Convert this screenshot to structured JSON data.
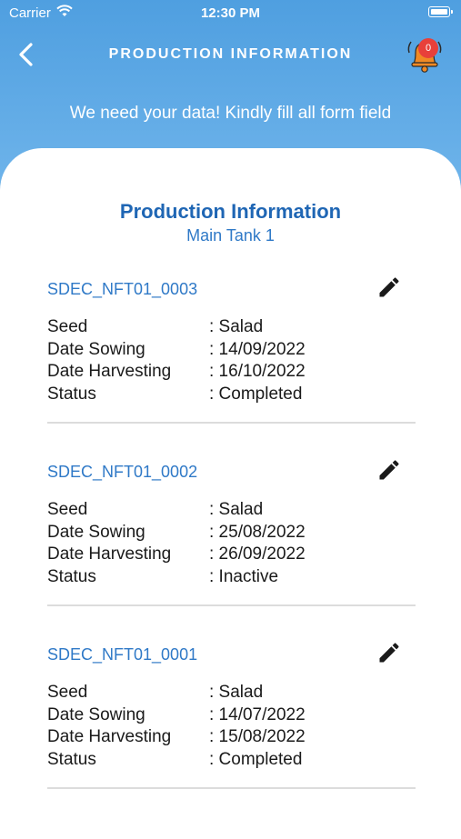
{
  "status_bar": {
    "carrier": "Carrier",
    "time": "12:30 PM"
  },
  "nav": {
    "title": "PRODUCTION INFORMATION",
    "notification_count": "0"
  },
  "subtitle": "We need your data! Kindly fill all form field",
  "section": {
    "title": "Production Information",
    "subtitle": "Main Tank 1"
  },
  "field_labels": {
    "seed": "Seed",
    "date_sowing": "Date Sowing",
    "date_harvesting": "Date Harvesting",
    "status": "Status"
  },
  "records": [
    {
      "id": "SDEC_NFT01_0003",
      "seed": ": Salad",
      "date_sowing": ": 14/09/2022",
      "date_harvesting": ": 16/10/2022",
      "status": ": Completed"
    },
    {
      "id": "SDEC_NFT01_0002",
      "seed": ": Salad",
      "date_sowing": ": 25/08/2022",
      "date_harvesting": ": 26/09/2022",
      "status": ": Inactive"
    },
    {
      "id": "SDEC_NFT01_0001",
      "seed": ": Salad",
      "date_sowing": ": 14/07/2022",
      "date_harvesting": ": 15/08/2022",
      "status": ": Completed"
    }
  ],
  "icons": {
    "back": "chevron-left-icon",
    "bell": "bell-icon",
    "edit": "pencil-icon",
    "wifi": "wifi-icon",
    "battery": "battery-icon"
  },
  "colors": {
    "header_blue": "#5aa6e0",
    "title_blue": "#1f66b4",
    "link_blue": "#2f79c7",
    "bell_orange": "#f08a24",
    "badge_red": "#e8403a"
  }
}
